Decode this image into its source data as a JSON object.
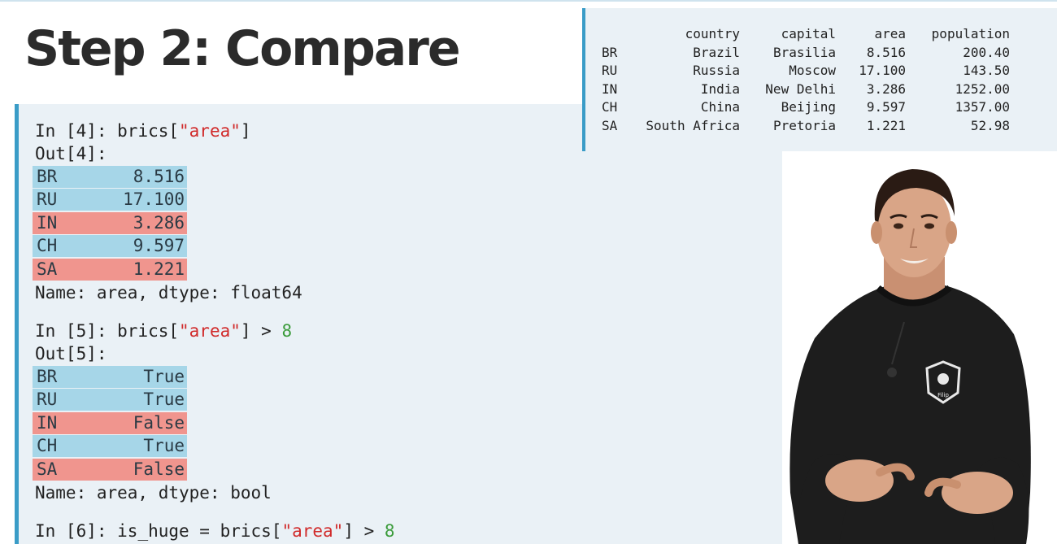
{
  "slide": {
    "title": "Step 2: Compare"
  },
  "code": {
    "in4": {
      "prompt": "In [4]: ",
      "code_pre": "brics[",
      "str": "\"area\"",
      "code_post": "]"
    },
    "out4_label": "Out[4]:",
    "out4_rows": [
      {
        "key": "BR",
        "value": "8.516",
        "highlight": "blue"
      },
      {
        "key": "RU",
        "value": "17.100",
        "highlight": "blue"
      },
      {
        "key": "IN",
        "value": "3.286",
        "highlight": "red"
      },
      {
        "key": "CH",
        "value": "9.597",
        "highlight": "blue"
      },
      {
        "key": "SA",
        "value": "1.221",
        "highlight": "red"
      }
    ],
    "out4_footer": "Name: area, dtype: float64",
    "in5": {
      "prompt": "In [5]: ",
      "code_pre": "brics[",
      "str": "\"area\"",
      "code_post": "] > ",
      "num": "8"
    },
    "out5_label": "Out[5]:",
    "out5_rows": [
      {
        "key": "BR",
        "value": "True",
        "highlight": "blue"
      },
      {
        "key": "RU",
        "value": "True",
        "highlight": "blue"
      },
      {
        "key": "IN",
        "value": "False",
        "highlight": "red"
      },
      {
        "key": "CH",
        "value": "True",
        "highlight": "blue"
      },
      {
        "key": "SA",
        "value": "False",
        "highlight": "red"
      }
    ],
    "out5_footer": "Name: area, dtype: bool",
    "in6": {
      "prompt": "In [6]: ",
      "code_pre": "is_huge = brics[",
      "str": "\"area\"",
      "code_post": "] > ",
      "num": "8"
    }
  },
  "table": {
    "headers": [
      "",
      "country",
      "capital",
      "area",
      "population"
    ],
    "rows": [
      [
        "BR",
        "Brazil",
        "Brasilia",
        "8.516",
        "200.40"
      ],
      [
        "RU",
        "Russia",
        "Moscow",
        "17.100",
        "143.50"
      ],
      [
        "IN",
        "India",
        "New Delhi",
        "3.286",
        "1252.00"
      ],
      [
        "CH",
        "China",
        "Beijing",
        "9.597",
        "1357.00"
      ],
      [
        "SA",
        "South Africa",
        "Pretoria",
        "1.221",
        "52.98"
      ]
    ]
  },
  "video": {
    "shirt_logo_text": "Filip"
  },
  "colors": {
    "accent": "#3a9cc7",
    "panel_bg": "#eaf1f6",
    "highlight_blue": "#a6d6e8",
    "highlight_red": "#f0958e",
    "string": "#d12b2b",
    "number": "#3a9b3a"
  }
}
